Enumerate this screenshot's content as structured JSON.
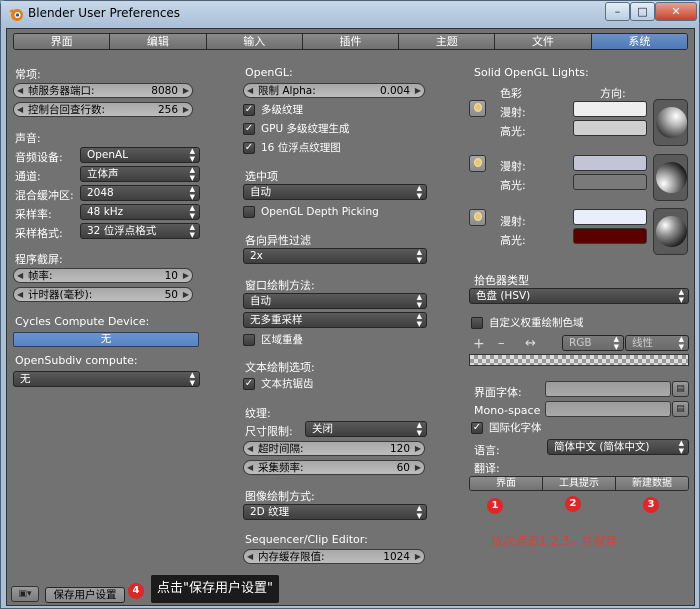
{
  "window": {
    "title": "Blender User Preferences",
    "min": "–",
    "max": "□",
    "close": "✕"
  },
  "tabs": [
    "界面",
    "编辑",
    "输入",
    "插件",
    "主题",
    "文件",
    "系统"
  ],
  "col1": {
    "general_title": "常项:",
    "frame_server_label": "帧服务器端口:",
    "frame_server_value": "8080",
    "console_label": "控制台回查行数:",
    "console_value": "256",
    "sound_title": "声音:",
    "audio_device_label": "音频设备:",
    "audio_device_value": "OpenAL",
    "channels_label": "通道:",
    "channels_value": "立体声",
    "mix_buffer_label": "混合缓冲区:",
    "mix_buffer_value": "2048",
    "sample_rate_label": "采样率:",
    "sample_rate_value": "48 kHz",
    "sample_format_label": "采样格式:",
    "sample_format_value": "32 位浮点格式",
    "screencast_title": "程序截屏:",
    "fps_label": "帧率:",
    "fps_value": "10",
    "timer_label": "计时器(毫秒):",
    "timer_value": "50",
    "cycles_title": "Cycles Compute Device:",
    "cycles_value": "无",
    "opensubdiv_title": "OpenSubdiv compute:",
    "opensubdiv_value": "无"
  },
  "col2": {
    "opengl_title": "OpenGL:",
    "clip_alpha_label": "限制 Alpha:",
    "clip_alpha_value": "0.004",
    "mipmaps": "多级纹理",
    "gpu_mipmap": "GPU 多级纹理生成",
    "float_textures": "16 位浮点纹理图",
    "selection_title": "选中项",
    "selection_value": "自动",
    "depth_picking": "OpenGL Depth Picking",
    "anisotropic_title": "各向异性过滤",
    "anisotropic_value": "2x",
    "window_draw_title": "窗口绘制方法:",
    "window_draw_value": "自动",
    "multisample_value": "无多重采样",
    "region_overlap": "区域重叠",
    "text_draw_title": "文本绘制选项:",
    "text_antialias": "文本抗锯齿",
    "textures_title": "纹理:",
    "size_limit_label": "尺寸限制:",
    "size_limit_value": "关闭",
    "time_out_label": "超时间隔:",
    "time_out_value": "120",
    "collection_rate_label": "采集频率:",
    "collection_rate_value": "60",
    "image_draw_title": "图像绘制方式:",
    "image_draw_value": "2D 纹理",
    "sequencer_title": "Sequencer/Clip Editor:",
    "memory_cache_label": "内存缓存限值:",
    "memory_cache_value": "1024"
  },
  "col3": {
    "lights_title": "Solid OpenGL Lights:",
    "colors_header": "色彩",
    "direction_header": "方向:",
    "diffuse": "漫射:",
    "specular": "高光:",
    "lights": [
      {
        "diffuse": "#eeeeee",
        "specular": "#cfcfcf",
        "sphere": "light1"
      },
      {
        "diffuse": "#c3c5d6",
        "specular": "#7a7a7a",
        "sphere": "light2"
      },
      {
        "diffuse": "#eaeefc",
        "specular": "#5a0000",
        "sphere": "light3"
      }
    ],
    "color_picker_title": "拾色器类型",
    "color_picker_value": "色盘 (HSV)",
    "custom_weight": "自定义权重绘制色域",
    "ramp_add": "+",
    "ramp_remove": "–",
    "ramp_flip": "↔",
    "ramp_mode": "RGB",
    "ramp_interp": "线性",
    "interface_font_label": "界面字体:",
    "mono_font_label": "Mono-space ...",
    "international_fonts": "国际化字体",
    "language_label": "语言:",
    "language_value": "简体中文 (简体中文)",
    "translate_label": "翻译:",
    "translate_buttons": [
      "界面",
      "工具提示",
      "新建数据"
    ]
  },
  "annotations": {
    "b1": "1",
    "b2": "2",
    "b3": "3",
    "b4": "4",
    "note": "依次点击1,2,3，并保存",
    "tooltip": "点击\"保存用户设置\""
  },
  "footer": {
    "save_label": "保存用户设置"
  }
}
